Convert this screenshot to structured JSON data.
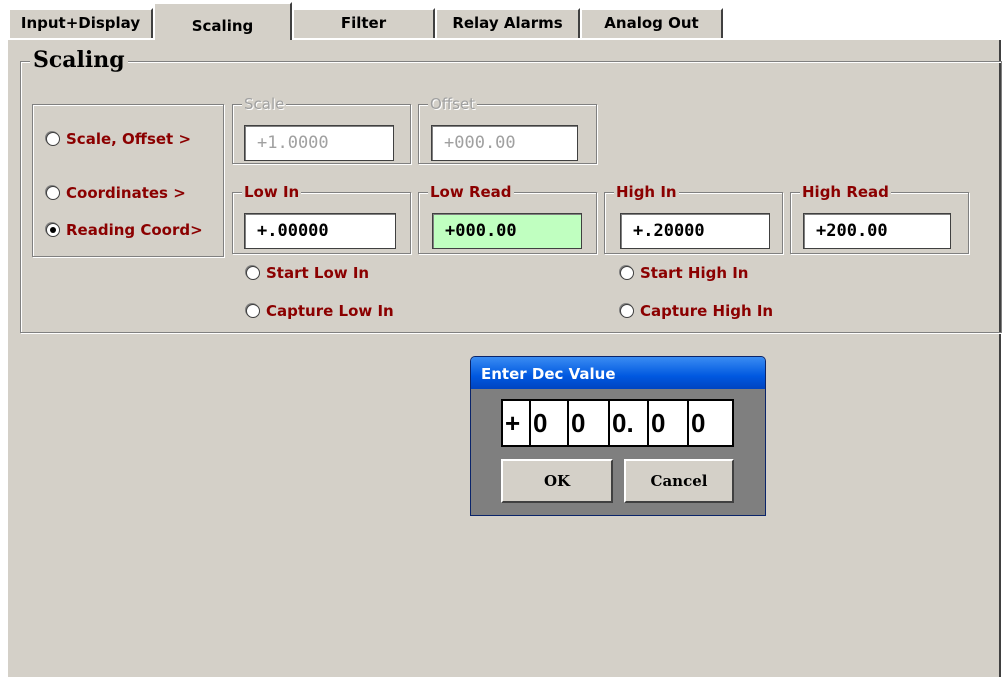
{
  "tabs": [
    "Input+Display",
    "Scaling",
    "Filter",
    "Relay Alarms",
    "Analog Out"
  ],
  "active_tab": "Scaling",
  "group_title": "Scaling",
  "modes": [
    {
      "label": "Scale, Offset  >",
      "selected": false
    },
    {
      "label": "Coordinates  >",
      "selected": false
    },
    {
      "label": "Reading Coord>",
      "selected": true
    }
  ],
  "scale": {
    "label": "Scale",
    "value": "+1.0000",
    "enabled": false
  },
  "offset": {
    "label": "Offset",
    "value": "+000.00",
    "enabled": false
  },
  "low_in": {
    "label": "Low In",
    "value": "+.00000"
  },
  "low_read": {
    "label": "Low Read",
    "value": "+000.00"
  },
  "high_in": {
    "label": "High In",
    "value": "+.20000"
  },
  "high_read": {
    "label": "High Read",
    "value": "+200.00"
  },
  "low_actions": [
    {
      "label": "Start Low In",
      "selected": false
    },
    {
      "label": "Capture Low In",
      "selected": false
    }
  ],
  "high_actions": [
    {
      "label": "Start High In",
      "selected": false
    },
    {
      "label": "Capture High In",
      "selected": false
    }
  ],
  "dialog": {
    "title": "Enter Dec Value",
    "digits": [
      "+",
      "0",
      "0",
      "0.",
      "0",
      "0"
    ],
    "ok": "OK",
    "cancel": "Cancel"
  },
  "colors": {
    "label_red": "#8b0000",
    "highlight_green": "#c0ffc0",
    "window_bg": "#d4d0c8",
    "dialog_title_blue": "#0058e0"
  }
}
